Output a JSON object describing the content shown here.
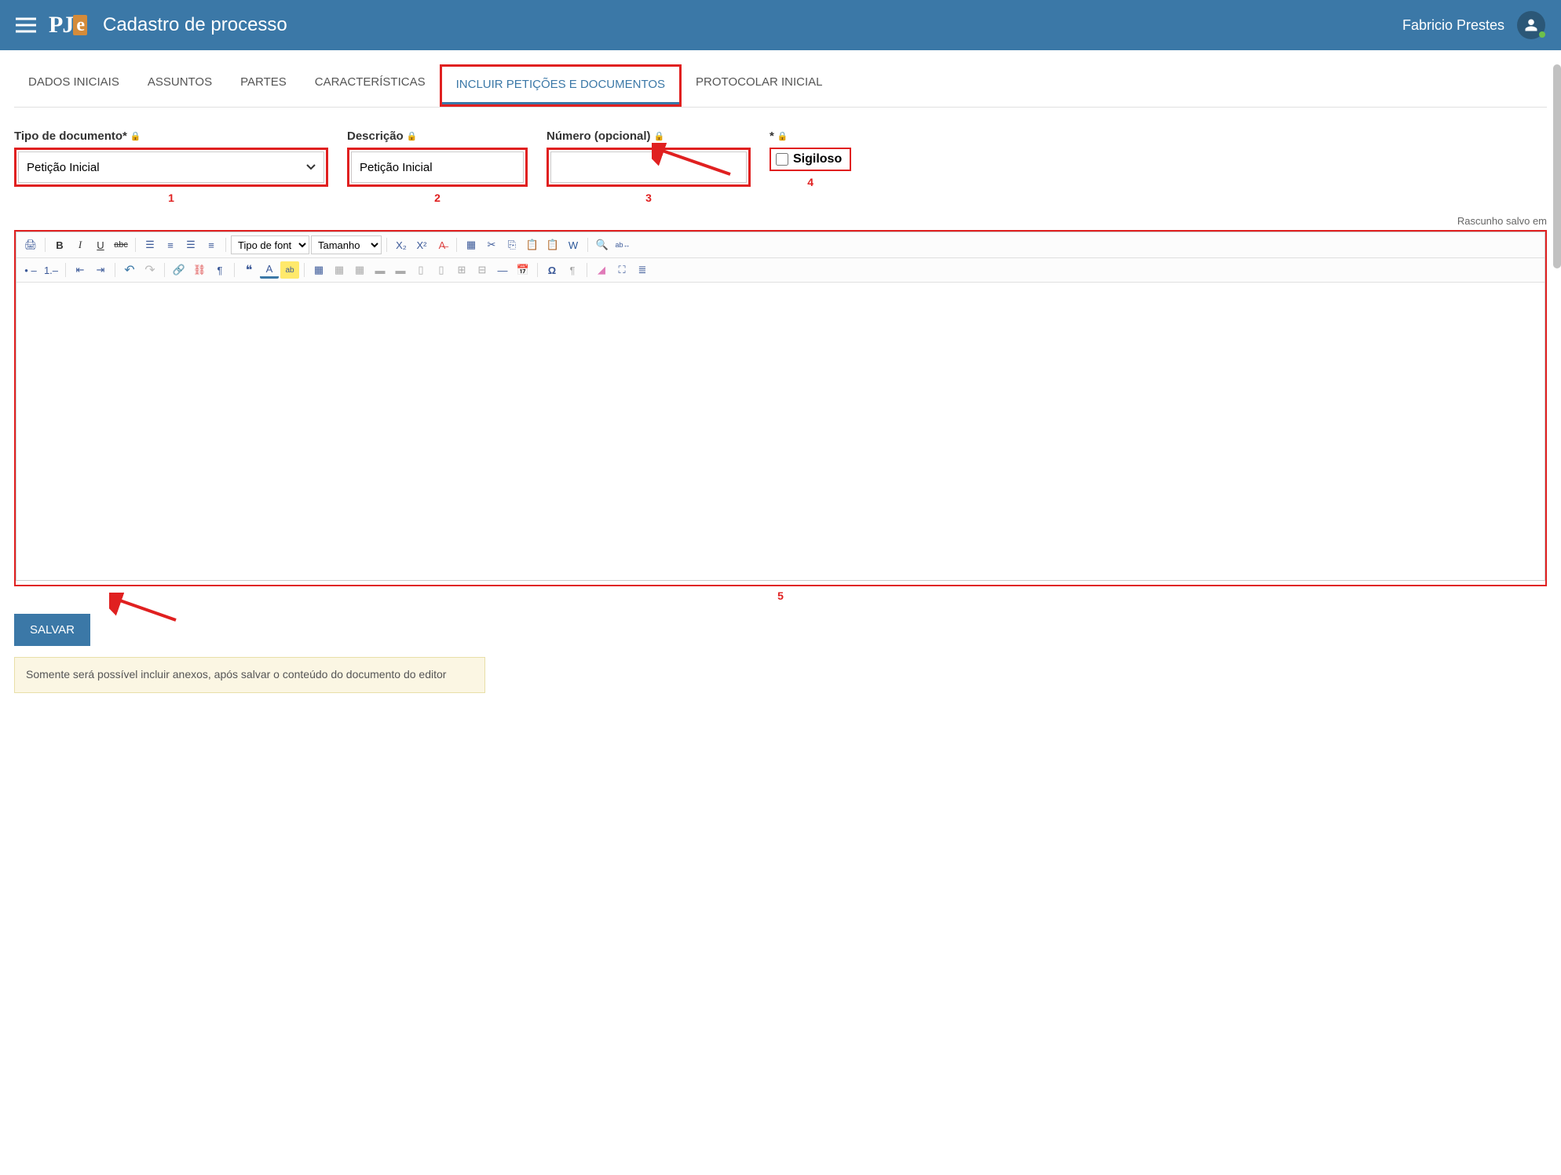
{
  "header": {
    "logo_text": "PJe",
    "page_title": "Cadastro de processo",
    "user_name": "Fabricio Prestes"
  },
  "tabs": [
    {
      "label": "DADOS INICIAIS",
      "active": false
    },
    {
      "label": "ASSUNTOS",
      "active": false
    },
    {
      "label": "PARTES",
      "active": false
    },
    {
      "label": "CARACTERÍSTICAS",
      "active": false
    },
    {
      "label": "INCLUIR PETIÇÕES E DOCUMENTOS",
      "active": true
    },
    {
      "label": "PROTOCOLAR INICIAL",
      "active": false
    }
  ],
  "form": {
    "doc_type_label": "Tipo de documento*",
    "doc_type_value": "Petição Inicial",
    "description_label": "Descrição",
    "description_value": "Petição Inicial",
    "number_label": "Número (opcional)",
    "number_value": "",
    "sigiloso_header": "*",
    "sigiloso_label": "Sigiloso",
    "sigiloso_checked": false
  },
  "annotations": {
    "n1": "1",
    "n2": "2",
    "n3": "3",
    "n4": "4",
    "n5": "5"
  },
  "draft_saved": "Rascunho salvo em",
  "editor_toolbar": {
    "font_family_label": "Tipo de font",
    "font_size_label": "Tamanho"
  },
  "editor_content": "",
  "save_button": "SALVAR",
  "info_message": "Somente será possível incluir anexos, após salvar o conteúdo do documento do editor"
}
